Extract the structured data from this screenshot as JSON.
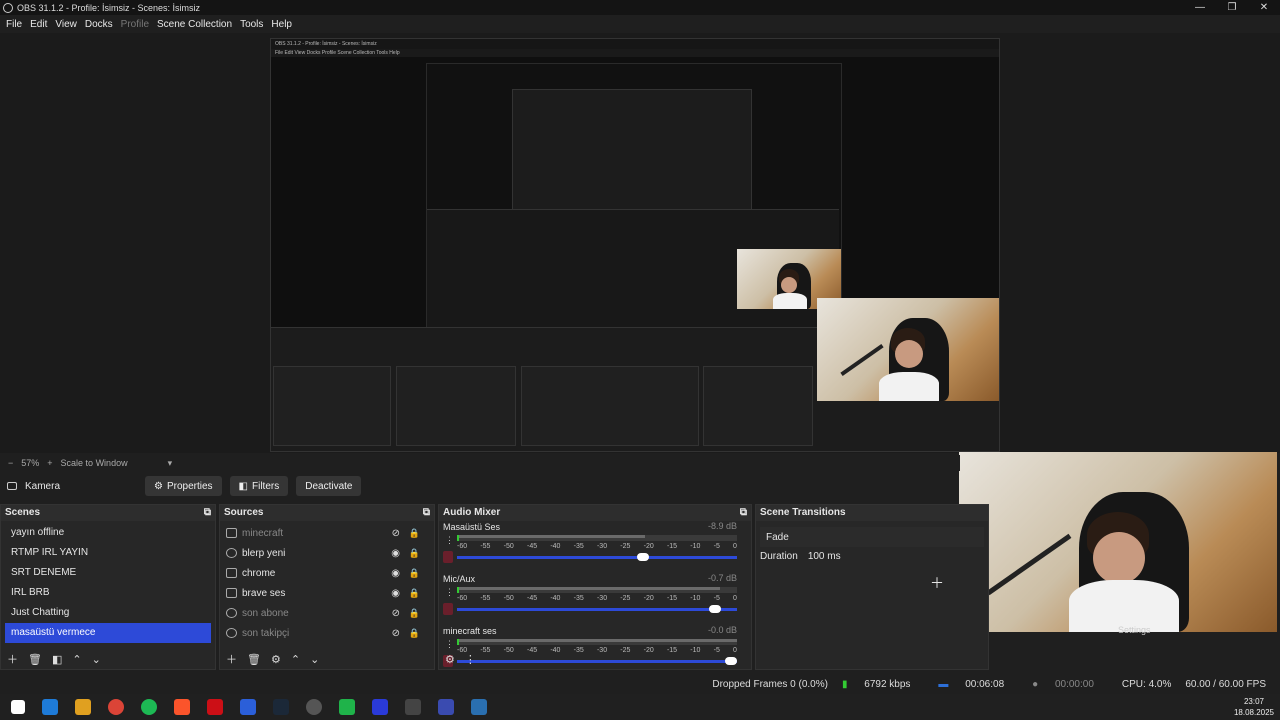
{
  "window": {
    "title": "OBS 31.1.2 - Profile: İsimsiz - Scenes: İsimsiz"
  },
  "window_controls": {
    "minimize": "—",
    "restore": "❐",
    "close": "✕"
  },
  "menu": {
    "items": [
      "File",
      "Edit",
      "View",
      "Docks",
      "Profile",
      "Scene Collection",
      "Tools",
      "Help"
    ]
  },
  "nested_preview": {
    "title": "OBS 31.1.2 - Profile: İsimsiz - Scenes: İsimsiz",
    "menu": "File  Edit  View  Docks  Profile  Scene Collection  Tools  Help"
  },
  "preview_bar": {
    "zoom_minus": "−",
    "zoom": "57%",
    "zoom_plus": "+",
    "scale": "Scale to Window",
    "dropdown": "▾"
  },
  "properties_bar": {
    "source_name": "Kamera",
    "properties": "Properties",
    "filters": "Filters",
    "deactivate": "Deactivate"
  },
  "scenes": {
    "title": "Scenes",
    "items": [
      "yayın offline",
      "RTMP IRL YAYIN",
      "SRT DENEME",
      "IRL BRB",
      "Just Chatting",
      "masaüstü vermece"
    ],
    "selected_index": 5
  },
  "sources": {
    "title": "Sources",
    "items": [
      {
        "name": "minecraft",
        "visible": false
      },
      {
        "name": "blerp yeni",
        "visible": true
      },
      {
        "name": "chrome",
        "visible": true
      },
      {
        "name": "brave ses",
        "visible": true
      },
      {
        "name": "son abone",
        "visible": false
      },
      {
        "name": "son takipçi",
        "visible": false
      }
    ]
  },
  "audio_mixer": {
    "title": "Audio Mixer",
    "ticks": [
      "-60",
      "-55",
      "-50",
      "-45",
      "-40",
      "-35",
      "-30",
      "-25",
      "-20",
      "-15",
      "-10",
      "-5",
      "0"
    ],
    "channels": [
      {
        "name": "Masaüstü Ses",
        "db": "-8.9 dB",
        "volume": 0.67
      },
      {
        "name": "Mic/Aux",
        "db": "-0.7 dB",
        "volume": 0.94
      },
      {
        "name": "minecraft ses",
        "db": "-0.0 dB",
        "volume": 1.0
      }
    ]
  },
  "scene_transitions": {
    "title": "Scene Transitions",
    "transition": "Fade",
    "duration_label": "Duration",
    "duration_value": "100 ms",
    "settings": "Settings"
  },
  "status": {
    "dropped_frames": "Dropped Frames 0 (0.0%)",
    "bitrate": "6792 kbps",
    "stream_time": "00:06:08",
    "rec_time": "00:00:00",
    "cpu": "CPU: 4.0%",
    "fps": "60.00 / 60.00 FPS"
  },
  "taskbar": {
    "time": "23:07",
    "date": "18.08.2025",
    "icon_colors": [
      "#1e7bd8",
      "#e0a020",
      "#db4437",
      "#1db954",
      "#fb542b",
      "#cc0f16",
      "#2b5fd9",
      "#1b2838",
      "#555555",
      "#1fb34a",
      "#2a3ad9",
      "#444444",
      "#3a4bb0",
      "#2a6fb0"
    ]
  }
}
